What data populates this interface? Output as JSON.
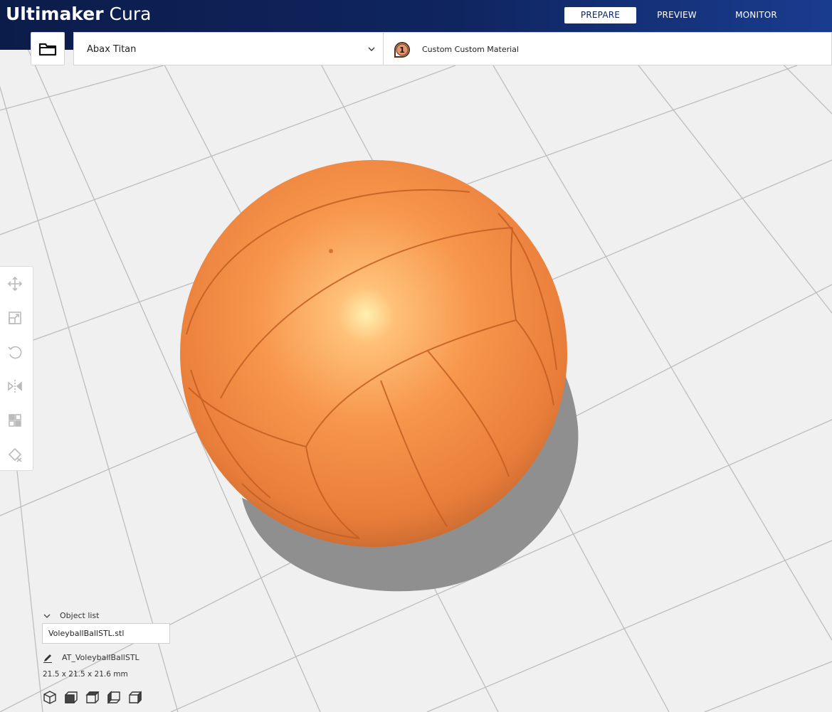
{
  "app": {
    "brand": "Ultimaker",
    "product": "Cura"
  },
  "stages": {
    "prepare": "PREPARE",
    "preview": "PREVIEW",
    "monitor": "MONITOR",
    "active": "prepare"
  },
  "toolbar": {
    "open_file_icon": "folder-icon",
    "printer_name": "Abax Titan",
    "printer_dropdown_icon": "chevron-down-icon",
    "extruder_number": "1",
    "material_name": "Custom Custom Material"
  },
  "tools": [
    {
      "name": "move",
      "icon": "move-icon"
    },
    {
      "name": "scale",
      "icon": "scale-icon"
    },
    {
      "name": "rotate",
      "icon": "rotate-icon"
    },
    {
      "name": "mirror",
      "icon": "mirror-icon"
    },
    {
      "name": "per-model-settings",
      "icon": "per-model-settings-icon"
    },
    {
      "name": "support-blocker",
      "icon": "support-blocker-icon"
    }
  ],
  "object_list": {
    "header": "Object list",
    "file_name": "VoleyballBallSTL.stl",
    "object_name": "AT_VoleyballBallSTL",
    "dimensions": "21.5 x 21.5 x 21.6 mm"
  },
  "view_buttons": [
    {
      "name": "3d-view",
      "icon": "cube-3d-icon"
    },
    {
      "name": "front-view",
      "icon": "cube-front-icon"
    },
    {
      "name": "top-view",
      "icon": "cube-top-icon"
    },
    {
      "name": "left-view",
      "icon": "cube-left-icon"
    },
    {
      "name": "right-view",
      "icon": "cube-right-icon"
    }
  ],
  "colors": {
    "header_dark": "#0f2560",
    "build_plate": "#f0f0f0",
    "grid_line": "#bfbfbf",
    "model_orange": "#f79a4f",
    "model_shadow": "#8f8f8f"
  }
}
